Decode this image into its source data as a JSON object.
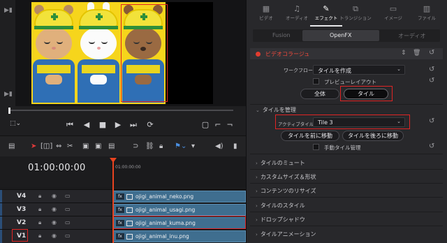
{
  "viewer": {
    "characters": [
      "cat",
      "rabbit",
      "bear"
    ]
  },
  "timeline": {
    "timecode": "01:00:00:00",
    "ruler_label": "01:00:00:00",
    "tracks": [
      {
        "label": "V4",
        "clip": "ojigi_animal_neko.png"
      },
      {
        "label": "V3",
        "clip": "ojigi_animal_usagi.png"
      },
      {
        "label": "V2",
        "clip": "ojigi_animal_kuma.png"
      },
      {
        "label": "V1",
        "clip": "ojigi_animal_inu.png"
      }
    ]
  },
  "inspector": {
    "tabs": [
      {
        "label": "ビデオ",
        "icon": "video-icon"
      },
      {
        "label": "オーディオ",
        "icon": "audio-icon"
      },
      {
        "label": "エフェクト",
        "icon": "effects-icon"
      },
      {
        "label": "トランジション",
        "icon": "transition-icon"
      },
      {
        "label": "イメージ",
        "icon": "image-icon"
      },
      {
        "label": "ファイル",
        "icon": "file-icon"
      }
    ],
    "subtabs": [
      "Fusion",
      "OpenFX",
      "オーディオ"
    ],
    "effect_title": "ビデオコラージュ",
    "workflow_label": "ワークフロー",
    "workflow_value": "タイルを作成",
    "preview_layout": "プレビューレイアウト",
    "btn_all": "全体",
    "btn_tile": "タイル",
    "manage_tile": "タイルを管理",
    "active_tile_label": "アクティブタイル",
    "active_tile_value": "Tile 3",
    "btn_move_front": "タイルを前に移動",
    "btn_move_back": "タイルを後ろに移動",
    "manual_tile": "手動タイル管理",
    "sections": [
      "タイルのミュート",
      "カスタムサイズ＆形状",
      "コンテンツのリサイズ",
      "タイルのスタイル",
      "ドロップシャドウ",
      "タイルアニメーション"
    ]
  }
}
